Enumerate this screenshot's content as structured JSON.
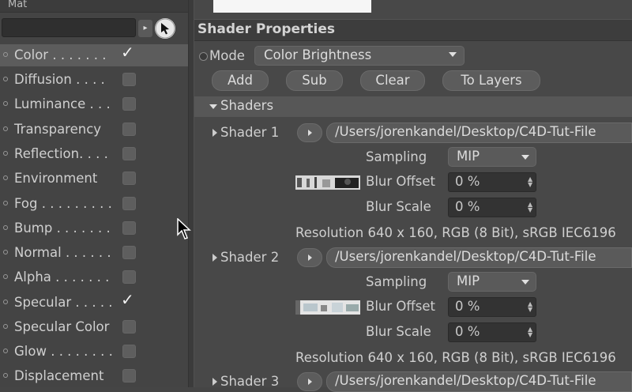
{
  "left_panel": {
    "title": "Mat",
    "channels": [
      {
        "label": "Color . . . . . . .",
        "checked": true,
        "selected": true
      },
      {
        "label": "Diffusion . . . .",
        "checked": false
      },
      {
        "label": "Luminance . . .",
        "checked": false
      },
      {
        "label": "Transparency",
        "checked": false
      },
      {
        "label": "Reflection. . . .",
        "checked": false
      },
      {
        "label": "Environment",
        "checked": false
      },
      {
        "label": "Fog . . . . . . . . .",
        "checked": false
      },
      {
        "label": "Bump . . . . . . .",
        "checked": false
      },
      {
        "label": "Normal . . . . . .",
        "checked": false
      },
      {
        "label": "Alpha . . . . . . .",
        "checked": false
      },
      {
        "label": "Specular . . . . .",
        "checked": true
      },
      {
        "label": "Specular Color",
        "checked": false
      },
      {
        "label": "Glow . . . . . . . .",
        "checked": false
      },
      {
        "label": "Displacement",
        "checked": false
      }
    ],
    "check_glyph": "✓"
  },
  "shader_properties": {
    "title": "Shader Properties",
    "mode_label": "Mode",
    "mode_value": "Color Brightness",
    "buttons": {
      "add": "Add",
      "sub": "Sub",
      "clear": "Clear",
      "to_layers": "To Layers"
    }
  },
  "shaders": {
    "title": "Shaders",
    "items": [
      {
        "name": "Shader 1",
        "path": "/Users/jorenkandel/Desktop/C4D-Tut-File",
        "sampling_label": "Sampling",
        "sampling_value": "MIP",
        "blur_offset_label": "Blur Offset",
        "blur_offset_value": "0 %",
        "blur_scale_label": "Blur Scale",
        "blur_scale_value": "0 %",
        "resolution": "Resolution 640 x 160, RGB (8 Bit), sRGB IEC6196"
      },
      {
        "name": "Shader 2",
        "path": "/Users/jorenkandel/Desktop/C4D-Tut-File",
        "sampling_label": "Sampling",
        "sampling_value": "MIP",
        "blur_offset_label": "Blur Offset",
        "blur_offset_value": "0 %",
        "blur_scale_label": "Blur Scale",
        "blur_scale_value": "0 %",
        "resolution": "Resolution 640 x 160, RGB (8 Bit), sRGB IEC6196"
      },
      {
        "name": "Shader 3",
        "path": "/Users/jorenkandel/Desktop/C4D-Tut-File"
      }
    ]
  },
  "icons": {
    "picker": "cursor-picker-icon",
    "expand": "triangle-right-icon",
    "collapse": "triangle-down-icon",
    "play": "play-icon",
    "dropdown": "chevron-down-icon"
  },
  "colors": {
    "panel_bg": "#454545",
    "header_bg": "#3d3d3d",
    "button_bg": "#5c5c5c",
    "field_bg": "#333333",
    "text": "#d8d8d8"
  }
}
